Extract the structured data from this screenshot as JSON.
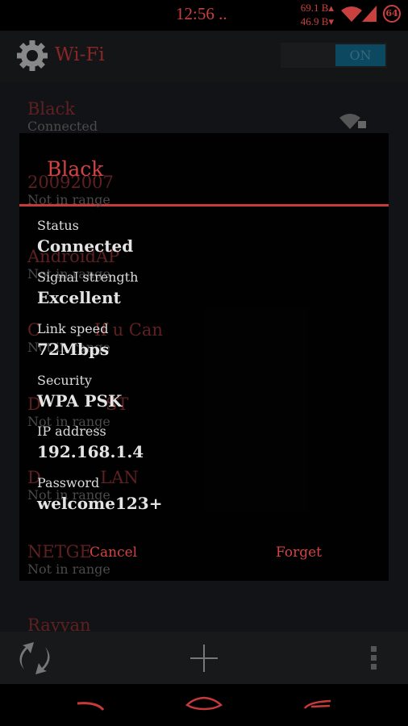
{
  "status_bar": {
    "time": "12:56 ..",
    "upload_rate": "69.1 B",
    "download_rate": "46.9 B",
    "battery": "64",
    "icons": [
      "wifi-signal-icon",
      "cell-signal-icon",
      "battery-icon"
    ]
  },
  "action_bar": {
    "title": "Wi-Fi",
    "toggle_label": "ON",
    "icon": "gear-icon"
  },
  "networks": [
    {
      "name": "Black",
      "status": "Connected"
    },
    {
      "name": "20092007",
      "status": "Not in range"
    },
    {
      "name": "AndroidAP",
      "status": "Not in range"
    },
    {
      "name": "C          If u Can",
      "status": "Not in range"
    },
    {
      "name": "D            ST",
      "status": "Not in range"
    },
    {
      "name": "D           LAN",
      "status": "Not in range"
    },
    {
      "name": "NETGE",
      "status": "Not in range"
    },
    {
      "name": "Rayyan",
      "status": ""
    }
  ],
  "dialog": {
    "title": "Black",
    "rows": [
      {
        "label": "Status",
        "value": "Connected"
      },
      {
        "label": "Signal strength",
        "value": "Excellent"
      },
      {
        "label": "Link speed",
        "value": "72Mbps"
      },
      {
        "label": "Security",
        "value": "WPA PSK"
      },
      {
        "label": "IP address",
        "value": "192.168.1.4"
      },
      {
        "label": "Password",
        "value": "welcome123+"
      }
    ],
    "cancel": "Cancel",
    "forget": "Forget"
  },
  "colors": {
    "accent": "#c8393b",
    "toggle": "#0c4860"
  }
}
